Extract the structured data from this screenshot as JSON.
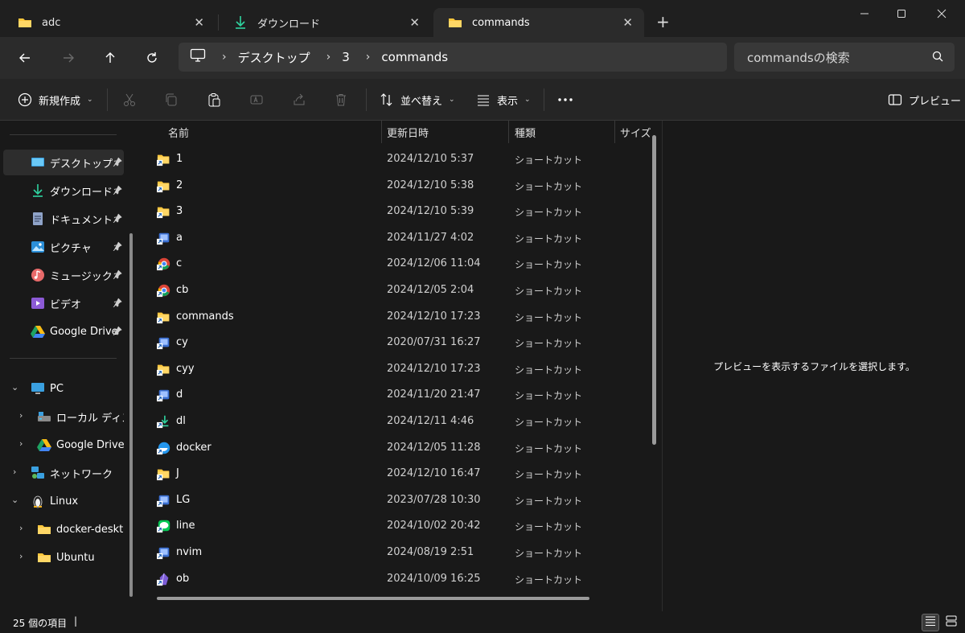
{
  "tabs": [
    {
      "label": "adc",
      "icon": "folder-icon"
    },
    {
      "label": "ダウンロード",
      "icon": "download-icon"
    },
    {
      "label": "commands",
      "icon": "folder-icon"
    }
  ],
  "address": {
    "crumbs": [
      "デスクトップ",
      "3",
      "commands"
    ],
    "search_placeholder": "commandsの検索"
  },
  "toolbar": {
    "new_label": "新規作成",
    "sort_label": "並べ替え",
    "view_label": "表示",
    "preview_label": "プレビュー"
  },
  "sidebar": {
    "quick_access": [
      {
        "label": "デスクトップ",
        "icon": "desktop-icon"
      },
      {
        "label": "ダウンロード",
        "icon": "download-icon"
      },
      {
        "label": "ドキュメント",
        "icon": "document-icon"
      },
      {
        "label": "ピクチャ",
        "icon": "picture-icon"
      },
      {
        "label": "ミュージック",
        "icon": "music-icon"
      },
      {
        "label": "ビデオ",
        "icon": "video-icon"
      },
      {
        "label": "Google Drive",
        "icon": "google-drive-icon"
      }
    ],
    "tree": [
      {
        "label": "PC",
        "icon": "pc-icon"
      },
      {
        "label": "ローカル ディスク",
        "icon": "drive-icon"
      },
      {
        "label": "Google Drive (",
        "icon": "google-drive-icon"
      },
      {
        "label": "ネットワーク",
        "icon": "network-icon"
      },
      {
        "label": "Linux",
        "icon": "linux-icon"
      },
      {
        "label": "docker-deskto",
        "icon": "folder-icon"
      },
      {
        "label": "Ubuntu",
        "icon": "folder-icon"
      }
    ]
  },
  "columns": {
    "name": "名前",
    "modified": "更新日時",
    "type": "種類",
    "size": "サイズ"
  },
  "files": [
    {
      "name": "1",
      "date": "2024/12/10 5:37",
      "type": "ショートカット",
      "icon": "folder-shortcut-icon"
    },
    {
      "name": "2",
      "date": "2024/12/10 5:38",
      "type": "ショートカット",
      "icon": "folder-shortcut-icon"
    },
    {
      "name": "3",
      "date": "2024/12/10 5:39",
      "type": "ショートカット",
      "icon": "folder-shortcut-icon"
    },
    {
      "name": "a",
      "date": "2024/11/27 4:02",
      "type": "ショートカット",
      "icon": "app-shortcut-icon"
    },
    {
      "name": "c",
      "date": "2024/12/06 11:04",
      "type": "ショートカット",
      "icon": "chrome-shortcut-icon"
    },
    {
      "name": "cb",
      "date": "2024/12/05 2:04",
      "type": "ショートカット",
      "icon": "chrome-shortcut-icon"
    },
    {
      "name": "commands",
      "date": "2024/12/10 17:23",
      "type": "ショートカット",
      "icon": "folder-shortcut-icon"
    },
    {
      "name": "cy",
      "date": "2020/07/31 16:27",
      "type": "ショートカット",
      "icon": "app-shortcut-icon"
    },
    {
      "name": "cyy",
      "date": "2024/12/10 17:23",
      "type": "ショートカット",
      "icon": "folder-shortcut-icon"
    },
    {
      "name": "d",
      "date": "2024/11/20 21:47",
      "type": "ショートカット",
      "icon": "app-shortcut-icon"
    },
    {
      "name": "dl",
      "date": "2024/12/11 4:46",
      "type": "ショートカット",
      "icon": "download-shortcut-icon"
    },
    {
      "name": "docker",
      "date": "2024/12/05 11:28",
      "type": "ショートカット",
      "icon": "docker-shortcut-icon"
    },
    {
      "name": "J",
      "date": "2024/12/10 16:47",
      "type": "ショートカット",
      "icon": "folder-shortcut-icon"
    },
    {
      "name": "LG",
      "date": "2023/07/28 10:30",
      "type": "ショートカット",
      "icon": "app-shortcut-icon"
    },
    {
      "name": "line",
      "date": "2024/10/02 20:42",
      "type": "ショートカット",
      "icon": "line-shortcut-icon"
    },
    {
      "name": "nvim",
      "date": "2024/08/19 2:51",
      "type": "ショートカット",
      "icon": "app-shortcut-icon"
    },
    {
      "name": "ob",
      "date": "2024/10/09 16:25",
      "type": "ショートカット",
      "icon": "obsidian-shortcut-icon"
    }
  ],
  "preview": {
    "message": "プレビューを表示するファイルを選択します。"
  },
  "status": {
    "item_count": "25 個の項目"
  },
  "colors": {
    "accent": "#4cc2ff",
    "folder": "#ffc83d",
    "background": "#191919"
  }
}
